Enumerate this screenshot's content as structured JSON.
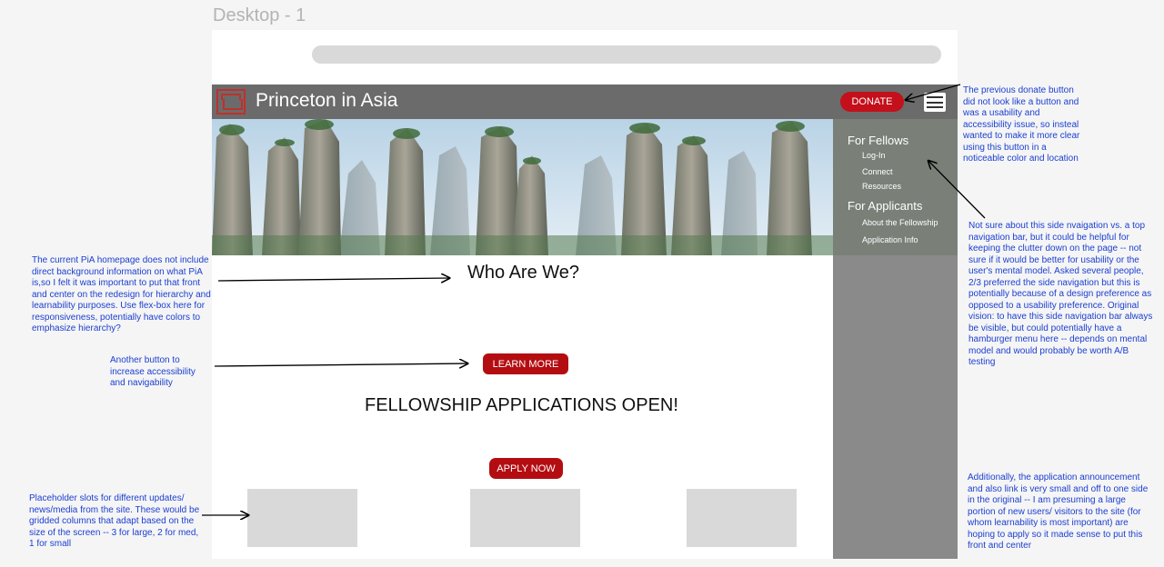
{
  "canvas": {
    "frame_title": "Desktop - 1"
  },
  "site": {
    "title": "Princeton in Asia",
    "donate_label": "DONATE",
    "who_heading": "Who Are We?",
    "learn_more_label": "LEARN MORE",
    "fellowship_banner": "FELLOWSHIP APPLICATIONS OPEN!",
    "apply_now_label": "APPLY NOW"
  },
  "sidebar": {
    "fellows_heading": "For Fellows",
    "fellows_items": [
      "Log-In",
      "Connect",
      "Resources"
    ],
    "applicants_heading": "For Applicants",
    "applicants_items": [
      "About the Fellowship",
      "Application Info"
    ]
  },
  "annotations": {
    "background_info": "The current PiA homepage does not include direct background information on what PiA is,so I felt it was important to put that front and center on the redesign for hierarchy and learnability purposes. Use flex-box here for responsiveness, potentially have colors to emphasize hierarchy?",
    "another_button": "Another button to increase accessibility and navigability",
    "placeholder_slots": "Placeholder slots for different updates/ news/media from the site. These would be gridded columns that adapt based on the size of the screen -- 3 for large, 2 for med, 1 for small",
    "donate_note": "The previous donate button did not look like a button and was a usability and accessibility issue, so insteal wanted to make it more clear using this button in a noticeable color and location",
    "side_nav_note": "Not sure about this side nvaigation vs. a top navigation bar, but it could be helpful for keeping the clutter down on the page -- not sure if it would be better for usability or the user's mental model. Asked several people, 2/3 preferred the side navigation but this is potentially because of a design preference as opposed to a usability preference. Original vision: to have this side navigation bar always be visible, but could potentially have a hamburger menu here -- depends on mental model and would probably be worth A/B testing",
    "application_note": "Additionally, the application announcement and also link is very small and off to one side in the original -- I am presuming a large portion of new users/ visitors to the site (for whom learnability is most important) are hoping to apply so it made sense to put this front and center"
  },
  "colors": {
    "accent": "#b30d12",
    "navbar": "#6b6b6b",
    "sidebar": "#8a8a8a",
    "annotation": "#1b3fd1",
    "placeholder": "#d9d9d9"
  },
  "icons": {
    "menu": "hamburger-menu-icon",
    "logo": "pia-logo-icon"
  }
}
